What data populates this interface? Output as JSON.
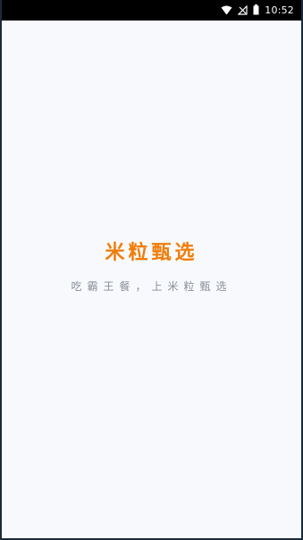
{
  "status_bar": {
    "time": "10:52",
    "icons": [
      "wifi-icon",
      "signal-off-icon",
      "battery-icon"
    ]
  },
  "splash": {
    "brand_name": "米粒甄选",
    "slogan": "吃霸王餐，上米粒甄选"
  },
  "colors": {
    "brand": "#f07d0a",
    "background": "#f7f9fc",
    "slogan": "#8a8f98",
    "status_bar": "#000000"
  }
}
